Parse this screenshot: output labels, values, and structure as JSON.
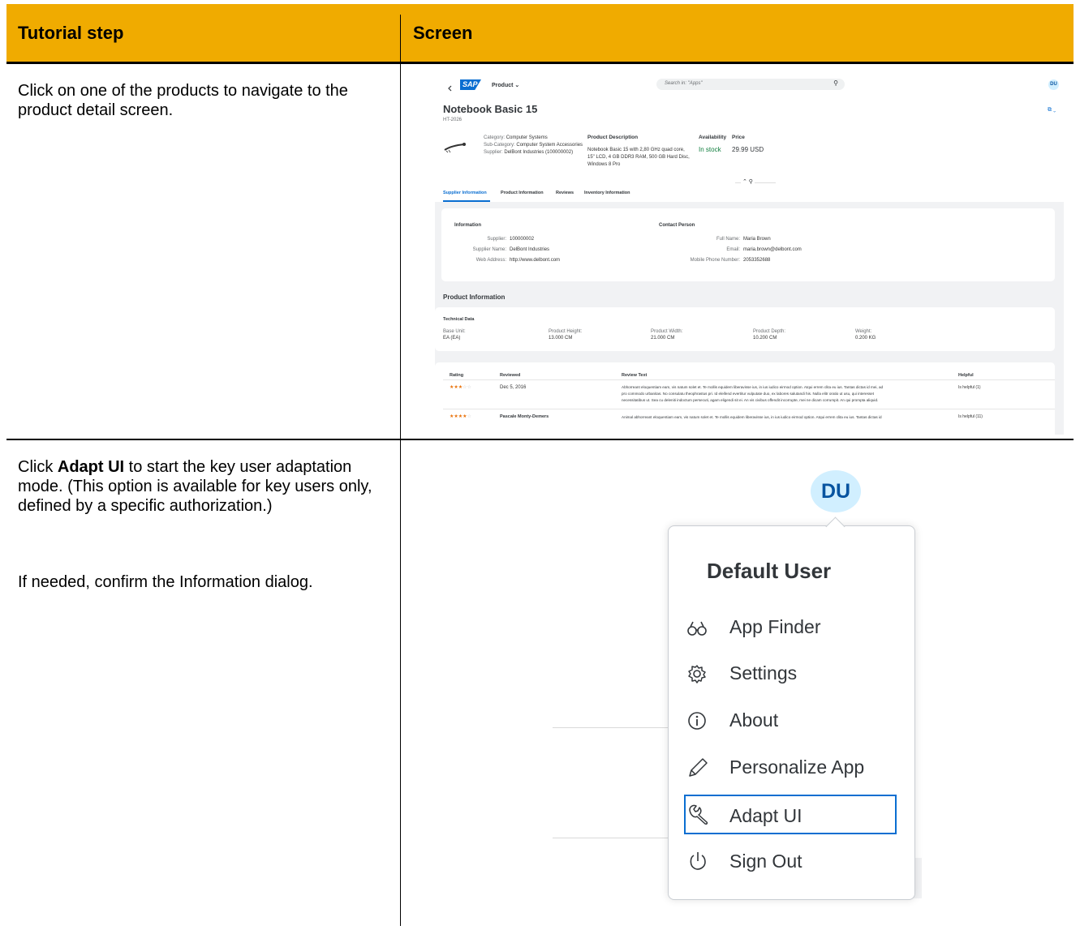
{
  "table": {
    "header_step": "Tutorial step",
    "header_screen": "Screen",
    "accent_color": "#f0ab00"
  },
  "rows": [
    {
      "step_text": "Click on one of the products to navigate to the product detail screen."
    },
    {
      "step_text_pre": "Click ",
      "step_text_bold": "Adapt UI",
      "step_text_post": " to start the key user adaptation mode. (This option is available for key users only, defined by a specific authorization.)",
      "step_text_2": "If needed, confirm the Information dialog."
    }
  ],
  "product_screen": {
    "back_icon": "chevron-left-icon",
    "logo": "SAP",
    "app_title": "Product",
    "search_placeholder": "Search in: \"Apps\"",
    "avatar": "DU",
    "product_name": "Notebook Basic 15",
    "product_id": "HT-2026",
    "category_label": "Category:",
    "category_value": "Computer Systems",
    "subcategory_label": "Sub-Category:",
    "subcategory_value": "Computer System Accessories",
    "supplier_label": "Supplier:",
    "supplier_value": "DelBont Industries (100000002)",
    "desc_title": "Product Description",
    "desc_text": "Notebook Basic 15 with 2,80 GHz quad core, 15\" LCD, 4 GB DDR3 RAM, 500 GB Hard Disc, Windows 8 Pro",
    "availability_label": "Availability",
    "availability_value": "In stock",
    "price_label": "Price",
    "price_value": "29.99 USD",
    "tabs": [
      "Supplier Information",
      "Product Information",
      "Reviews",
      "Inventory Information"
    ],
    "info_title": "Information",
    "supplier_id_label": "Supplier:",
    "supplier_id_value": "100000002",
    "supplier_name_label": "Supplier Name:",
    "supplier_name_value": "DelBont Industries",
    "web_label": "Web Address:",
    "web_value": "http://www.delbont.com",
    "contact_title": "Contact Person",
    "fullname_label": "Full Name:",
    "fullname_value": "Maria Brown",
    "email_label": "Email:",
    "email_value": "maria.brown@delbont.com",
    "phone_label": "Mobile Phone Number:",
    "phone_value": "2053352688",
    "product_info_title": "Product Information",
    "tech_title": "Technical Data",
    "tech": [
      {
        "label": "Base Unit:",
        "value": "EA (EA)"
      },
      {
        "label": "Product Height:",
        "value": "13.000  CM"
      },
      {
        "label": "Product Width:",
        "value": "21.000  CM"
      },
      {
        "label": "Product Depth:",
        "value": "10.200  CM"
      },
      {
        "label": "Weight:",
        "value": "0.200  KG"
      }
    ],
    "review_headers": [
      "Rating",
      "Reviewed",
      "Review Text",
      "Helpful"
    ],
    "reviews": [
      {
        "rating": 3,
        "reviewed": "Dec 5, 2016",
        "text_1": "Abhorreant eloquentiam eam, vis natum solet et. Te mollis equidem liberavisse ius, in ius iudico eirmod option. Atqui errem clita eu ius. Tantas dictas id mei, ad",
        "text_2": "pro commodo urbanitas. No consulatu theophrastus pri. Id eleifend evertitur vulputate duo, ex labores salutandi his. Nulla elitr oratio ut usu, qui interesset",
        "text_3": "necessitatibus ut. Sea cu deleniti indoctum persecuti, agam eligendi sit ei. An vis civibus offendit incorrupte, mei ne dicam corrumpit. An qui prompta aliquid.",
        "helpful": "Is helpful (1)"
      },
      {
        "rating": 4,
        "reviewed": "Pascale Monty-Demers",
        "text_1": "Animal abhorreant eloquentiam eam, vis natum solet et. Te mollis equidem liberavisse ius, in ius iudico eirmod option. Atqui errem clita eu ius. Tantas dictas id",
        "helpful": "Is helpful (11)"
      }
    ]
  },
  "user_menu": {
    "avatar": "DU",
    "title": "Default User",
    "items": [
      {
        "label": "App Finder",
        "icon": "binoculars-icon"
      },
      {
        "label": "Settings",
        "icon": "gear-icon"
      },
      {
        "label": "About",
        "icon": "info-icon"
      },
      {
        "label": "Personalize App",
        "icon": "pencil-icon"
      },
      {
        "label": "Adapt UI",
        "icon": "wrench-icon"
      },
      {
        "label": "Sign Out",
        "icon": "power-icon"
      }
    ],
    "highlight_color": "#0a6ed1"
  }
}
